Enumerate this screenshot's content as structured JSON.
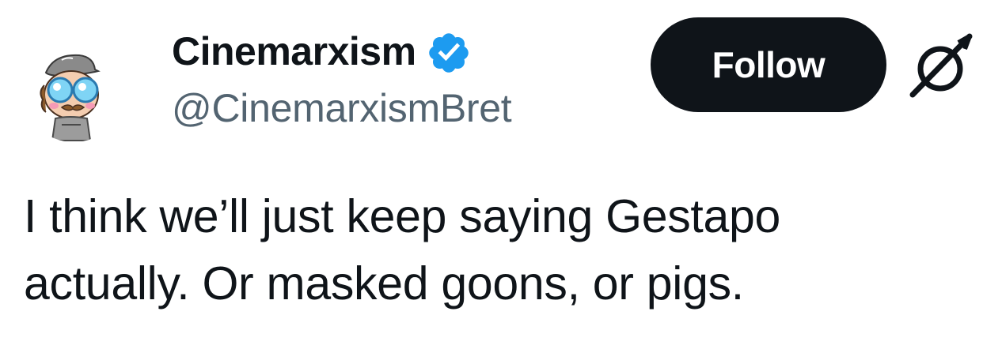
{
  "author": {
    "display_name": "Cinemarxism",
    "handle": "@CinemarxismBret",
    "verified": true,
    "verified_color": "#1d9bf0"
  },
  "actions": {
    "follow_label": "Follow",
    "follow_bg": "#0f1419",
    "more_icon": "grok-icon"
  },
  "tweet": {
    "lines": [
      "I think we’ll just keep saying Gestapo",
      "actually. Or masked goons, or pigs."
    ]
  },
  "colors": {
    "text_primary": "#0f1419",
    "text_secondary": "#536471"
  }
}
